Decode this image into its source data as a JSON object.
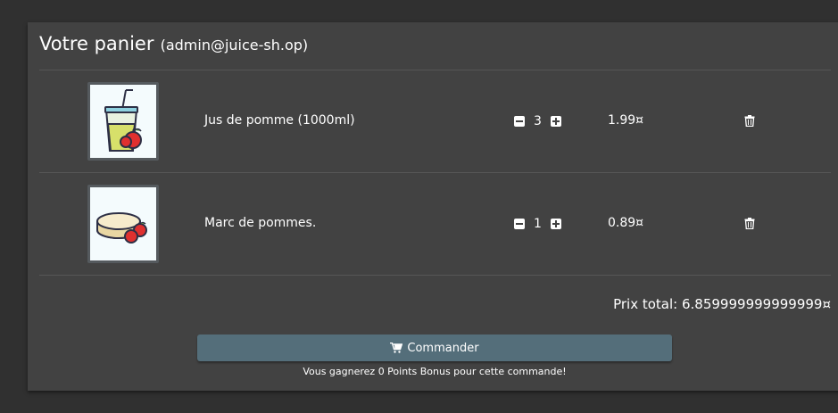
{
  "basket": {
    "title": "Votre panier",
    "user": "(admin@juice-sh.op)"
  },
  "items": [
    {
      "name": "Jus de pomme (1000ml)",
      "quantity": "3",
      "price": "1.99¤",
      "image_icon": "apple-juice-icon"
    },
    {
      "name": "Marc de pommes.",
      "quantity": "1",
      "price": "0.89¤",
      "image_icon": "apple-pomace-icon"
    }
  ],
  "summary": {
    "total": "Prix total: 6.859999999999999¤"
  },
  "checkout": {
    "label": "Commander",
    "bonus_note": "Vous gagnerez 0 Points Bonus pour cette commande!"
  },
  "colors": {
    "background": "#303030",
    "card": "#424242",
    "accent_button": "#546e7a"
  }
}
